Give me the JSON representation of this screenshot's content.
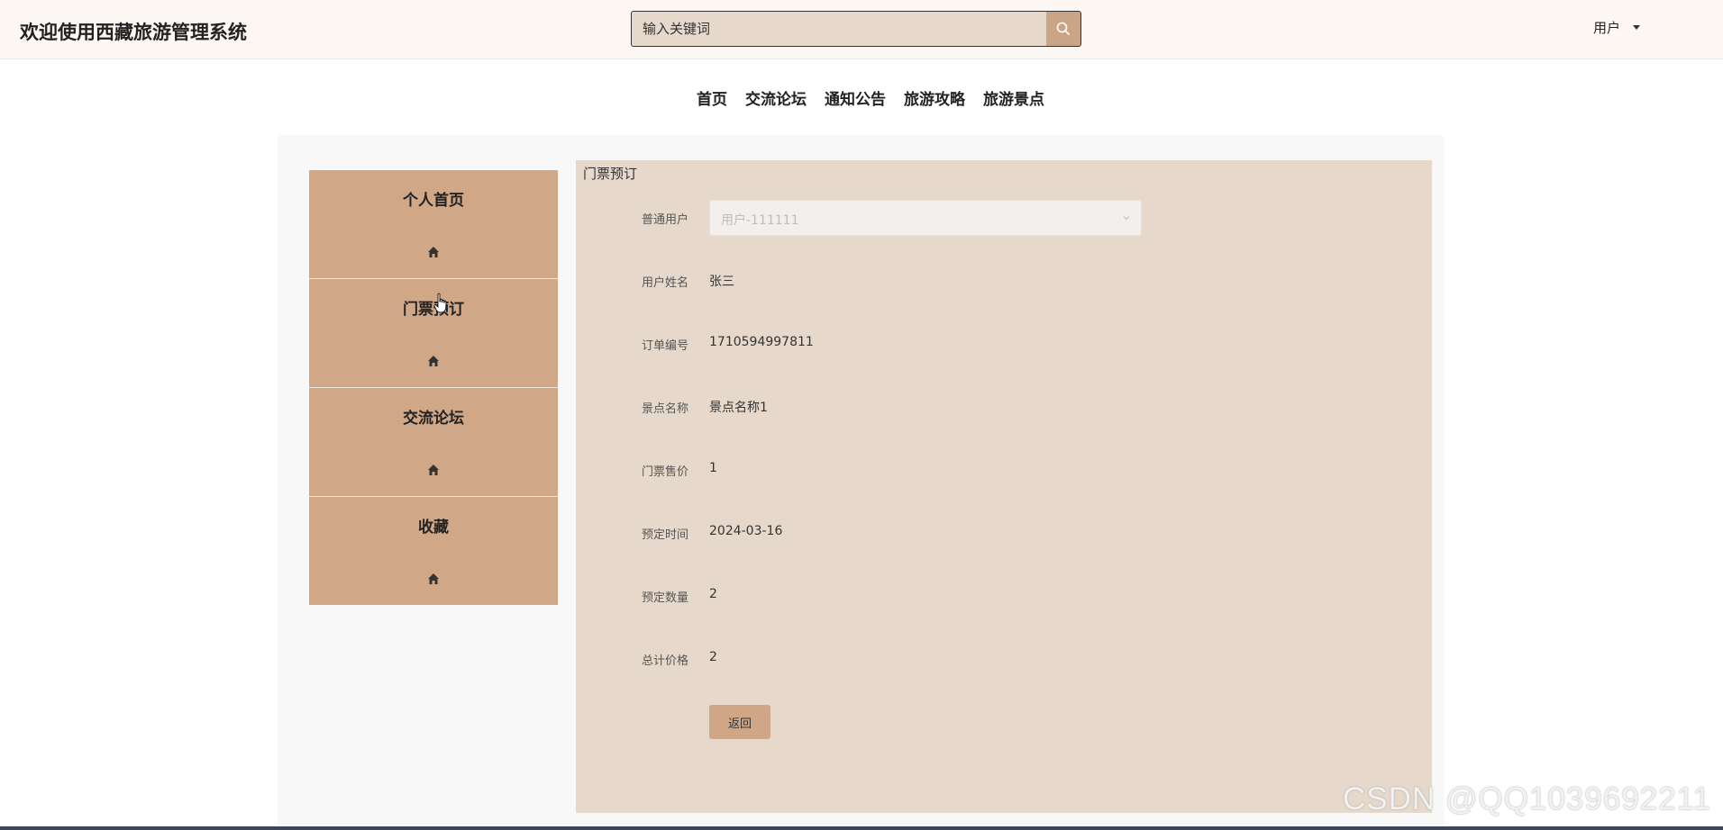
{
  "header": {
    "site_title": "欢迎使用西藏旅游管理系统",
    "search_placeholder": "输入关键词",
    "search_icon": "search-icon",
    "user_label": "用户",
    "user_caret_icon": "caret-down-icon"
  },
  "nav": {
    "items": [
      {
        "label": "首页"
      },
      {
        "label": "交流论坛"
      },
      {
        "label": "通知公告"
      },
      {
        "label": "旅游攻略"
      },
      {
        "label": "旅游景点"
      }
    ]
  },
  "sidebar": {
    "items": [
      {
        "label": "个人首页",
        "icon": "home-icon"
      },
      {
        "label": "门票预订",
        "icon": "home-icon"
      },
      {
        "label": "交流论坛",
        "icon": "home-icon"
      },
      {
        "label": "收藏",
        "icon": "home-icon"
      }
    ]
  },
  "form": {
    "title": "门票预订",
    "user_type": {
      "label": "普通用户",
      "value": "用户-111111"
    },
    "user_name": {
      "label": "用户姓名",
      "value": "张三"
    },
    "order_no": {
      "label": "订单编号",
      "value": "1710594997811"
    },
    "spot_name": {
      "label": "景点名称",
      "value": "景点名称1"
    },
    "ticket_price": {
      "label": "门票售价",
      "value": "1"
    },
    "book_time": {
      "label": "预定时间",
      "value": "2024-03-16"
    },
    "book_count": {
      "label": "预定数量",
      "value": "2"
    },
    "total_price": {
      "label": "总计价格",
      "value": "2"
    },
    "back_label": "返回"
  },
  "watermark": "CSDN @QQ1039692211",
  "colors": {
    "header_bg": "#fdf7f4",
    "accent": "#d0a787",
    "content_bg": "#e6d9cb",
    "search_bg": "#e6d8ca"
  }
}
